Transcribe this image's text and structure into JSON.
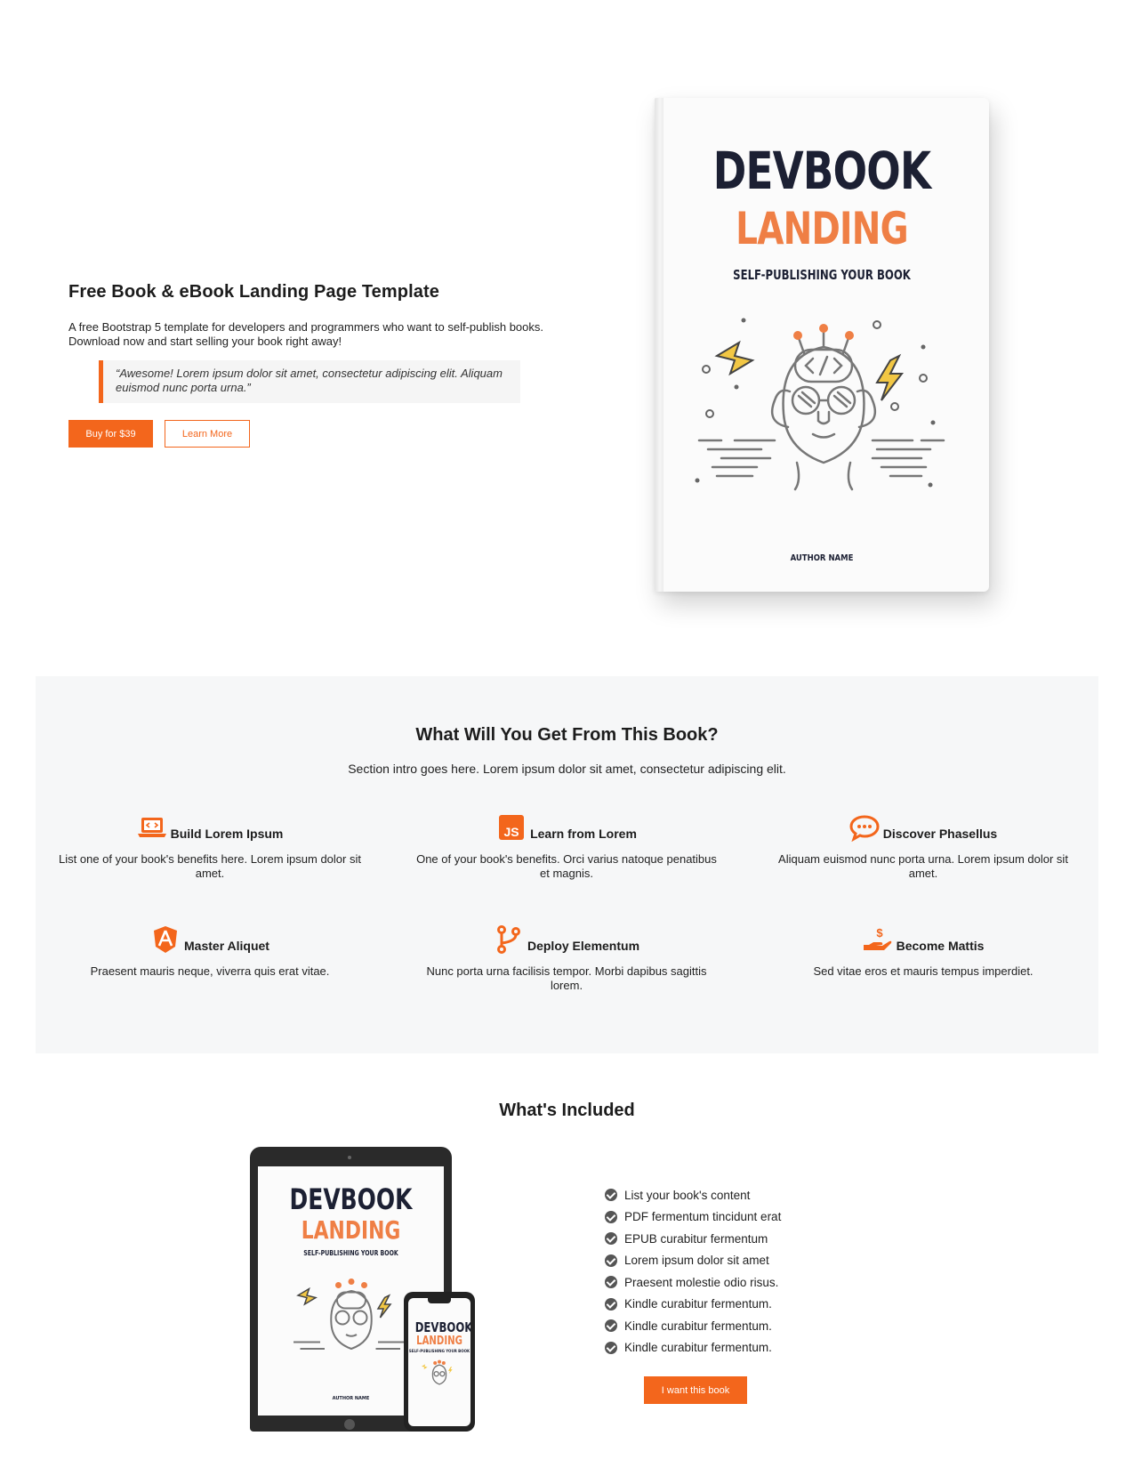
{
  "hero": {
    "title": "Free Book & eBook Landing Page Template",
    "intro": "A free Bootstrap 5 template for developers and programmers who want to self-publish books. Download now and start selling your book right away!",
    "quote": "“Awesome! Lorem ipsum dolor sit amet, consectetur adipiscing elit. Aliquam euismod nunc porta urna.”",
    "buy_label": "Buy for $39",
    "learn_label": "Learn More"
  },
  "cover": {
    "line1": "DEVBOOK",
    "line2": "LANDING",
    "subtitle": "SELF-PUBLISHING YOUR BOOK",
    "author": "AUTHOR NAME"
  },
  "benefits": {
    "title": "What Will You Get From This Book?",
    "intro": "Section intro goes here. Lorem ipsum dolor sit amet, consectetur adipiscing elit.",
    "items": [
      {
        "icon": "laptop-code-icon",
        "title": "Build Lorem Ipsum",
        "text": "List one of your book's benefits here. Lorem ipsum dolor sit amet."
      },
      {
        "icon": "js-icon",
        "title": "Learn from Lorem",
        "text": "One of your book's benefits. Orci varius natoque penatibus et magnis."
      },
      {
        "icon": "chat-bubble-icon",
        "title": "Discover Phasellus",
        "text": "Aliquam euismod nunc porta urna. Lorem ipsum dolor sit amet."
      },
      {
        "icon": "angular-icon",
        "title": "Master Aliquet",
        "text": "Praesent mauris neque, viverra quis erat vitae."
      },
      {
        "icon": "git-branch-icon",
        "title": "Deploy Elementum",
        "text": "Nunc porta urna facilisis tempor. Morbi dapibus sagittis lorem."
      },
      {
        "icon": "hand-dollar-icon",
        "title": "Become Mattis",
        "text": "Sed vitae eros et mauris tempus imperdiet."
      }
    ]
  },
  "included": {
    "title": "What's Included",
    "items": [
      "List your book's content",
      "PDF fermentum tincidunt erat",
      "EPUB curabitur fermentum",
      "Lorem ipsum dolor sit amet",
      "Praesent molestie odio risus.",
      "Kindle curabitur fermentum.",
      "Kindle curabitur fermentum.",
      "Kindle curabitur fermentum."
    ],
    "cta_label": "I want this book"
  },
  "colors": {
    "accent": "#f3661c",
    "cover_dark": "#1c2033",
    "cover_orange": "#ef7f45",
    "section_bg": "#f6f7f8"
  }
}
